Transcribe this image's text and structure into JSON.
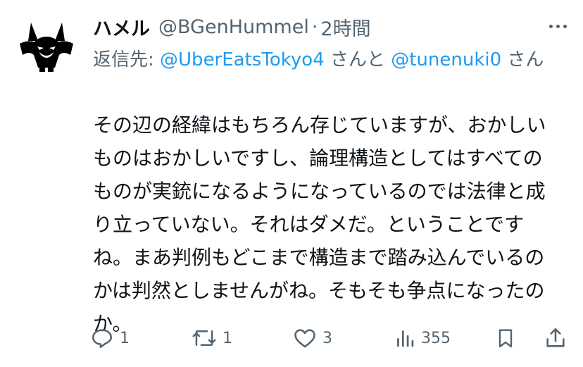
{
  "tweet": {
    "display_name": "ハメル",
    "handle": "@BGenHummel",
    "separator": "·",
    "time": "2時間",
    "reply_prefix": "返信先: ",
    "reply_mention_1": "@UberEatsTokyo4",
    "reply_middle": " さんと ",
    "reply_mention_2": "@tunenuki0",
    "reply_suffix": " さん",
    "text": "その辺の経緯はもちろん存じていますが、おかしいものはおかしいですし、論理構造としてはすべてのものが実銃になるようになっているのでは法律と成り立っていない。それはダメだ。ということですね。まあ判例もどこまで構造まで踏み込んでいるのかは判然としませんがね。そもそも争点になったのか。"
  },
  "actions": {
    "reply_count": "1",
    "retweet_count": "1",
    "like_count": "3",
    "views_count": "355"
  },
  "icons": {
    "avatar": "black-cat-mascot-avatar",
    "more": "more-icon",
    "reply": "reply-icon",
    "retweet": "retweet-icon",
    "like": "heart-icon",
    "views": "views-icon",
    "bookmark": "bookmark-icon",
    "share": "share-icon"
  },
  "colors": {
    "text": "#0f1419",
    "secondary": "#536471",
    "link": "#1d9bf0",
    "background": "#ffffff"
  }
}
